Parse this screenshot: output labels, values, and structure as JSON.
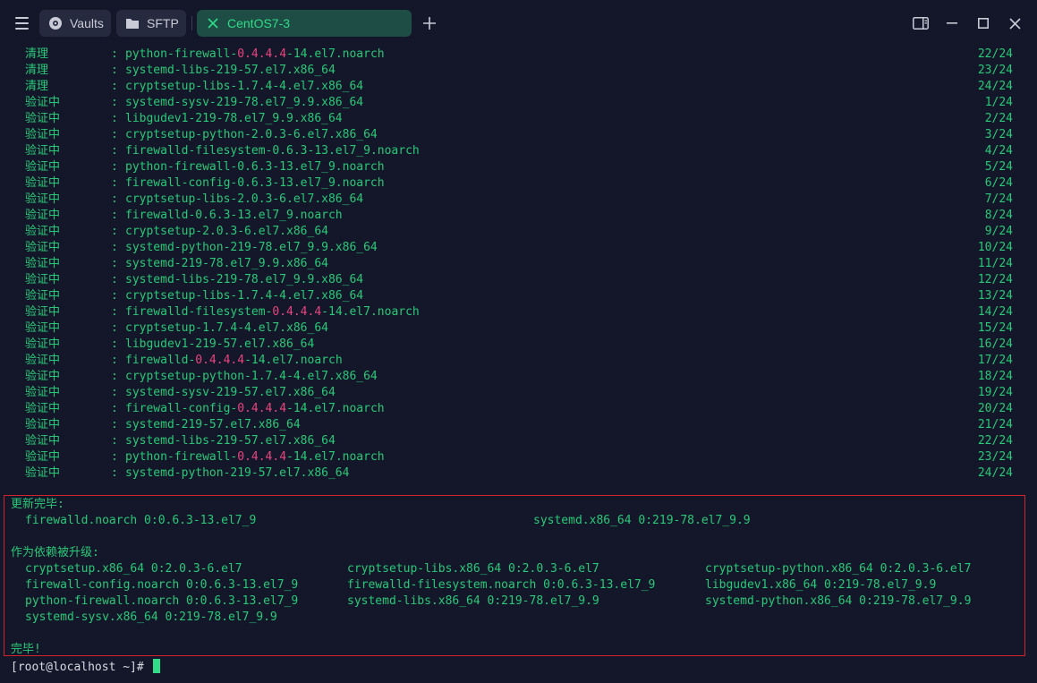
{
  "tabs": {
    "vaults": "Vaults",
    "sftp": "SFTP",
    "active": "CentOS7-3"
  },
  "colors": {
    "accent": "#2fdc87",
    "text": "#28c978",
    "highlight": "#e8457f",
    "frame": "#d0242a"
  },
  "rows": [
    {
      "label": "清理",
      "pre": "python-firewall-",
      "hl": "0.4.4.4",
      "post": "-14.el7.noarch",
      "num": "22/24"
    },
    {
      "label": "清理",
      "pre": "systemd-libs-219-57.el7.x86_64",
      "hl": "",
      "post": "",
      "num": "23/24"
    },
    {
      "label": "清理",
      "pre": "cryptsetup-libs-1.7.4-4.el7.x86_64",
      "hl": "",
      "post": "",
      "num": "24/24"
    },
    {
      "label": "验证中",
      "pre": "systemd-sysv-219-78.el7_9.9.x86_64",
      "hl": "",
      "post": "",
      "num": "1/24"
    },
    {
      "label": "验证中",
      "pre": "libgudev1-219-78.el7_9.9.x86_64",
      "hl": "",
      "post": "",
      "num": "2/24"
    },
    {
      "label": "验证中",
      "pre": "cryptsetup-python-2.0.3-6.el7.x86_64",
      "hl": "",
      "post": "",
      "num": "3/24"
    },
    {
      "label": "验证中",
      "pre": "firewalld-filesystem-0.6.3-13.el7_9.noarch",
      "hl": "",
      "post": "",
      "num": "4/24"
    },
    {
      "label": "验证中",
      "pre": "python-firewall-0.6.3-13.el7_9.noarch",
      "hl": "",
      "post": "",
      "num": "5/24"
    },
    {
      "label": "验证中",
      "pre": "firewall-config-0.6.3-13.el7_9.noarch",
      "hl": "",
      "post": "",
      "num": "6/24"
    },
    {
      "label": "验证中",
      "pre": "cryptsetup-libs-2.0.3-6.el7.x86_64",
      "hl": "",
      "post": "",
      "num": "7/24"
    },
    {
      "label": "验证中",
      "pre": "firewalld-0.6.3-13.el7_9.noarch",
      "hl": "",
      "post": "",
      "num": "8/24"
    },
    {
      "label": "验证中",
      "pre": "cryptsetup-2.0.3-6.el7.x86_64",
      "hl": "",
      "post": "",
      "num": "9/24"
    },
    {
      "label": "验证中",
      "pre": "systemd-python-219-78.el7_9.9.x86_64",
      "hl": "",
      "post": "",
      "num": "10/24"
    },
    {
      "label": "验证中",
      "pre": "systemd-219-78.el7_9.9.x86_64",
      "hl": "",
      "post": "",
      "num": "11/24"
    },
    {
      "label": "验证中",
      "pre": "systemd-libs-219-78.el7_9.9.x86_64",
      "hl": "",
      "post": "",
      "num": "12/24"
    },
    {
      "label": "验证中",
      "pre": "cryptsetup-libs-1.7.4-4.el7.x86_64",
      "hl": "",
      "post": "",
      "num": "13/24"
    },
    {
      "label": "验证中",
      "pre": "firewalld-filesystem-",
      "hl": "0.4.4.4",
      "post": "-14.el7.noarch",
      "num": "14/24"
    },
    {
      "label": "验证中",
      "pre": "cryptsetup-1.7.4-4.el7.x86_64",
      "hl": "",
      "post": "",
      "num": "15/24"
    },
    {
      "label": "验证中",
      "pre": "libgudev1-219-57.el7.x86_64",
      "hl": "",
      "post": "",
      "num": "16/24"
    },
    {
      "label": "验证中",
      "pre": "firewalld-",
      "hl": "0.4.4.4",
      "post": "-14.el7.noarch",
      "num": "17/24"
    },
    {
      "label": "验证中",
      "pre": "cryptsetup-python-1.7.4-4.el7.x86_64",
      "hl": "",
      "post": "",
      "num": "18/24"
    },
    {
      "label": "验证中",
      "pre": "systemd-sysv-219-57.el7.x86_64",
      "hl": "",
      "post": "",
      "num": "19/24"
    },
    {
      "label": "验证中",
      "pre": "firewall-config-",
      "hl": "0.4.4.4",
      "post": "-14.el7.noarch",
      "num": "20/24"
    },
    {
      "label": "验证中",
      "pre": "systemd-219-57.el7.x86_64",
      "hl": "",
      "post": "",
      "num": "21/24"
    },
    {
      "label": "验证中",
      "pre": "systemd-libs-219-57.el7.x86_64",
      "hl": "",
      "post": "",
      "num": "22/24"
    },
    {
      "label": "验证中",
      "pre": "python-firewall-",
      "hl": "0.4.4.4",
      "post": "-14.el7.noarch",
      "num": "23/24"
    },
    {
      "label": "验证中",
      "pre": "systemd-python-219-57.el7.x86_64",
      "hl": "",
      "post": "",
      "num": "24/24"
    }
  ],
  "summary": {
    "updated_title": "更新完毕:",
    "updated": [
      "firewalld.noarch 0:0.6.3-13.el7_9",
      "systemd.x86_64 0:219-78.el7_9.9"
    ],
    "deps_title": "作为依赖被升级:",
    "deps": [
      [
        "cryptsetup.x86_64 0:2.0.3-6.el7",
        "cryptsetup-libs.x86_64 0:2.0.3-6.el7",
        "cryptsetup-python.x86_64 0:2.0.3-6.el7"
      ],
      [
        "firewall-config.noarch 0:0.6.3-13.el7_9",
        "firewalld-filesystem.noarch 0:0.6.3-13.el7_9",
        "libgudev1.x86_64 0:219-78.el7_9.9"
      ],
      [
        "python-firewall.noarch 0:0.6.3-13.el7_9",
        "systemd-libs.x86_64 0:219-78.el7_9.9",
        "systemd-python.x86_64 0:219-78.el7_9.9"
      ],
      [
        "systemd-sysv.x86_64 0:219-78.el7_9.9",
        "",
        ""
      ]
    ],
    "done": "完毕!"
  },
  "prompt": "[root@localhost ~]#"
}
